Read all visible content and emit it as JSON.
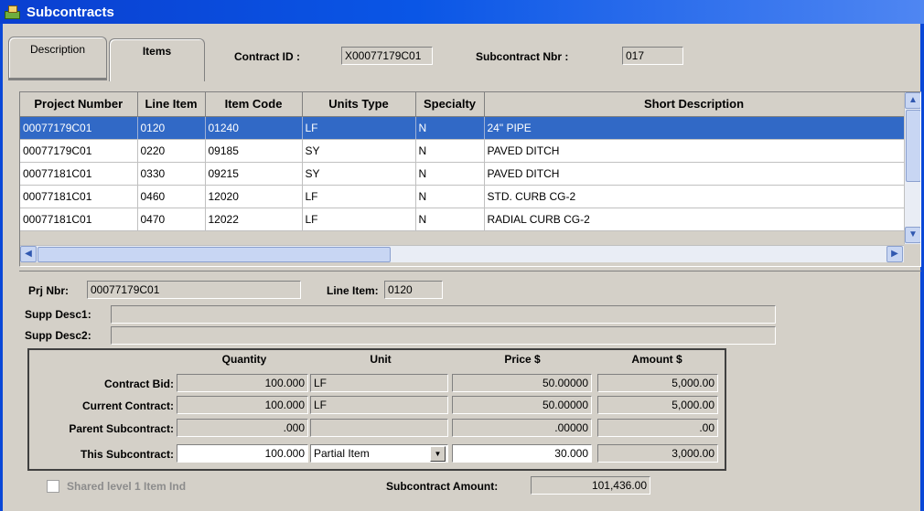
{
  "window": {
    "title": "Subcontracts"
  },
  "tabs": [
    {
      "label": "Description"
    },
    {
      "label": "Items"
    }
  ],
  "header": {
    "contract_id_label": "Contract ID :",
    "contract_id_value": "X00077179C01",
    "subcontract_nbr_label": "Subcontract Nbr :",
    "subcontract_nbr_value": "017"
  },
  "grid": {
    "columns": [
      "Project Number",
      "Line Item",
      "Item Code",
      "Units Type",
      "Specialty",
      "Short Description"
    ],
    "rows": [
      [
        "00077179C01",
        "0120",
        "01240",
        "LF",
        "N",
        "24\" PIPE"
      ],
      [
        "00077179C01",
        "0220",
        "09185",
        "SY",
        "N",
        "PAVED DITCH"
      ],
      [
        "00077181C01",
        "0330",
        "09215",
        "SY",
        "N",
        "PAVED DITCH"
      ],
      [
        "00077181C01",
        "0460",
        "12020",
        "LF",
        "N",
        "STD. CURB CG-2"
      ],
      [
        "00077181C01",
        "0470",
        "12022",
        "LF",
        "N",
        "RADIAL CURB CG-2"
      ]
    ],
    "selected_row": 0
  },
  "detail": {
    "prj_nbr_label": "Prj Nbr:",
    "prj_nbr_value": "00077179C01",
    "line_item_label": "Line Item:",
    "line_item_value": "0120",
    "supp_desc1_label": "Supp Desc1:",
    "supp_desc1_value": "",
    "supp_desc2_label": "Supp Desc2:",
    "supp_desc2_value": ""
  },
  "pricing": {
    "headers": {
      "quantity": "Quantity",
      "unit": "Unit",
      "price": "Price $",
      "amount": "Amount $"
    },
    "rows": [
      {
        "label": "Contract Bid:",
        "quantity": "100.000",
        "unit": "LF",
        "price": "50.00000",
        "amount": "5,000.00"
      },
      {
        "label": "Current Contract:",
        "quantity": "100.000",
        "unit": "LF",
        "price": "50.00000",
        "amount": "5,000.00"
      },
      {
        "label": "Parent Subcontract:",
        "quantity": ".000",
        "unit": "",
        "price": ".00000",
        "amount": ".00"
      },
      {
        "label": "This Subcontract:",
        "quantity": "100.000",
        "unit": "Partial Item",
        "price": "30.000",
        "amount": "3,000.00"
      }
    ]
  },
  "footer": {
    "shared_label": "Shared level 1 Item Ind",
    "shared_checked": false,
    "subcontract_amount_label": "Subcontract Amount:",
    "subcontract_amount_value": "101,436.00"
  },
  "icons": {
    "window_icon": "subcontracts-window-icon",
    "scroll_up": "scroll-up-arrow",
    "scroll_down": "scroll-down-arrow",
    "scroll_left": "scroll-left-arrow",
    "scroll_right": "scroll-right-arrow",
    "dropdown": "dropdown-arrow"
  },
  "colors": {
    "titlebar": "#0a56e6",
    "selection": "#3169c6",
    "dialog": "#d4d0c8"
  }
}
